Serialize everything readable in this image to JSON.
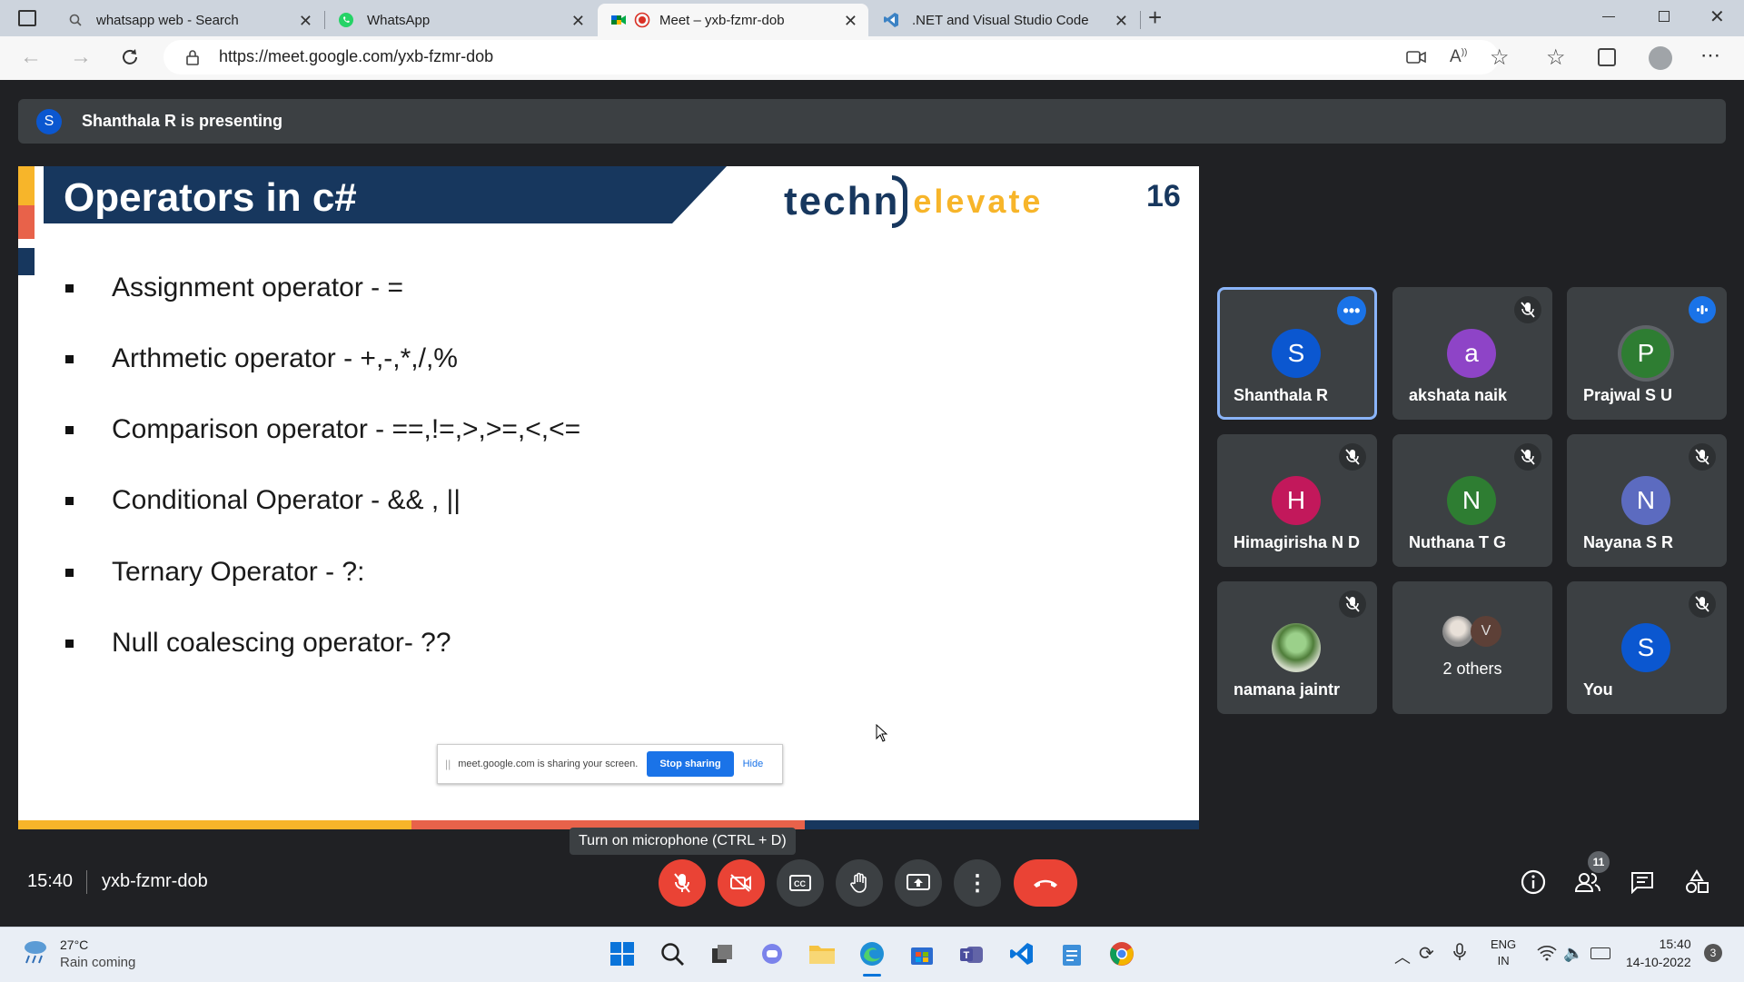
{
  "browser": {
    "tabs": [
      {
        "title": "whatsapp web - Search",
        "icon": "search-icon"
      },
      {
        "title": "WhatsApp",
        "icon": "whatsapp-icon"
      },
      {
        "title": "Meet – yxb-fzmr-dob",
        "icon": "meet-icon",
        "active": true
      },
      {
        "title": ".NET and Visual Studio Code",
        "icon": "vscode-icon"
      }
    ],
    "url": "https://meet.google.com/yxb-fzmr-dob"
  },
  "meet": {
    "presenting_initial": "S",
    "presenting_text": "Shanthala R is presenting",
    "slide": {
      "title": "Operators in c#",
      "logo_part1": "techn",
      "logo_part2": "elevate",
      "page_number": "16",
      "bullets": [
        "Assignment operator - =",
        "Arthmetic operator - +,-,*,/,%",
        "Comparison operator - ==,!=,>,>=,<,<=",
        "Conditional Operator - && , ||",
        "Ternary Operator - ?:",
        "Null coalescing operator- ??"
      ],
      "share_notice": "meet.google.com is sharing your screen.",
      "stop_sharing": "Stop sharing",
      "hide": "Hide"
    },
    "participants": [
      {
        "name": "Shanthala R",
        "initial": "S",
        "color": "#0b57d0",
        "status": "more"
      },
      {
        "name": "akshata naik",
        "initial": "a",
        "color": "#8e44c7",
        "status": "muted"
      },
      {
        "name": "Prajwal S U",
        "initial": "P",
        "color": "#2e7d32",
        "status": "speaking"
      },
      {
        "name": "Himagirisha N D",
        "initial": "H",
        "color": "#c2185b",
        "status": "muted"
      },
      {
        "name": "Nuthana T G",
        "initial": "N",
        "color": "#2e7d32",
        "status": "muted"
      },
      {
        "name": "Nayana S R",
        "initial": "N",
        "color": "#5c6bc0",
        "status": "muted"
      },
      {
        "name": "namana jaintr",
        "initial": "",
        "color": "#6b8e4e",
        "status": "muted"
      },
      {
        "name": "2 others",
        "initial": "V",
        "color": "#5d4037",
        "status": ""
      },
      {
        "name": "You",
        "initial": "S",
        "color": "#0b57d0",
        "status": "muted"
      }
    ],
    "tooltip": "Turn on microphone (CTRL + D)",
    "time": "15:40",
    "meeting_code": "yxb-fzmr-dob",
    "people_count": "11"
  },
  "taskbar": {
    "temp": "27°C",
    "weather": "Rain coming",
    "lang1": "ENG",
    "lang2": "IN",
    "clock_time": "15:40",
    "clock_date": "14-10-2022",
    "notifications": "3"
  }
}
